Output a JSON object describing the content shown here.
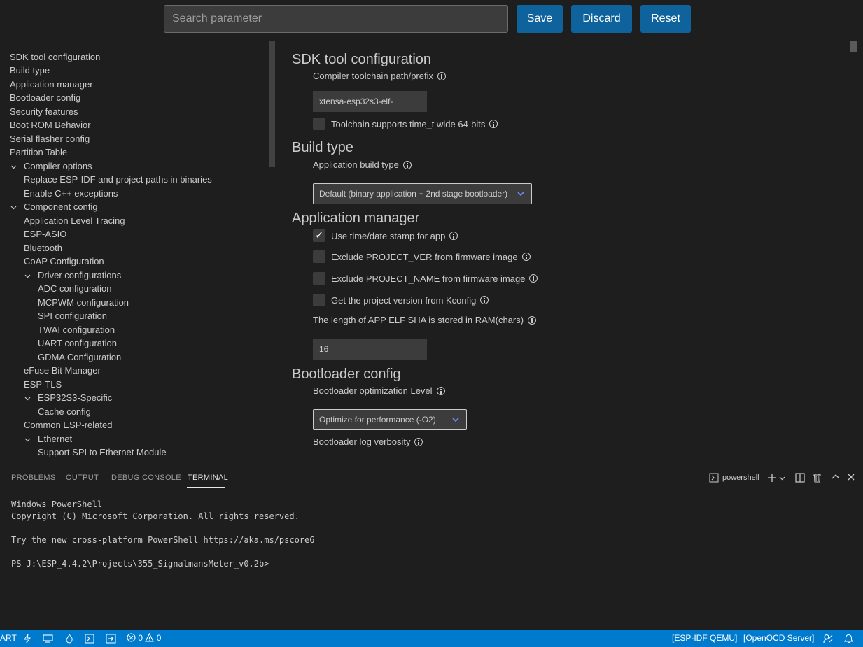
{
  "toolbar": {
    "search_placeholder": "Search parameter",
    "save_label": "Save",
    "discard_label": "Discard",
    "reset_label": "Reset"
  },
  "tree": {
    "items": [
      {
        "label": "SDK tool configuration"
      },
      {
        "label": "Build type"
      },
      {
        "label": "Application manager"
      },
      {
        "label": "Bootloader config"
      },
      {
        "label": "Security features"
      },
      {
        "label": "Boot ROM Behavior"
      },
      {
        "label": "Serial flasher config"
      },
      {
        "label": "Partition Table"
      },
      {
        "label": "Compiler options"
      },
      {
        "label": "Replace ESP-IDF and project paths in binaries"
      },
      {
        "label": "Enable C++ exceptions"
      },
      {
        "label": "Component config"
      },
      {
        "label": "Application Level Tracing"
      },
      {
        "label": "ESP-ASIO"
      },
      {
        "label": "Bluetooth"
      },
      {
        "label": "CoAP Configuration"
      },
      {
        "label": "Driver configurations"
      },
      {
        "label": "ADC configuration"
      },
      {
        "label": "MCPWM configuration"
      },
      {
        "label": "SPI configuration"
      },
      {
        "label": "TWAI configuration"
      },
      {
        "label": "UART configuration"
      },
      {
        "label": "GDMA Configuration"
      },
      {
        "label": "eFuse Bit Manager"
      },
      {
        "label": "ESP-TLS"
      },
      {
        "label": "ESP32S3-Specific"
      },
      {
        "label": "Cache config"
      },
      {
        "label": "Common ESP-related"
      },
      {
        "label": "Ethernet"
      },
      {
        "label": "Support SPI to Ethernet Module"
      }
    ]
  },
  "main": {
    "sdk": {
      "title": "SDK tool configuration",
      "toolchain_label": "Compiler toolchain path/prefix",
      "toolchain_value": "xtensa-esp32s3-elf-",
      "time_t_label": "Toolchain supports time_t wide 64-bits",
      "time_t_checked": false
    },
    "build": {
      "title": "Build type",
      "app_build_label": "Application build type",
      "app_build_value": "Default (binary application + 2nd stage bootloader)"
    },
    "appmgr": {
      "title": "Application manager",
      "timestamp_label": "Use time/date stamp for app",
      "timestamp_checked": true,
      "exclude_ver_label": "Exclude PROJECT_VER from firmware image",
      "exclude_ver_checked": false,
      "exclude_name_label": "Exclude PROJECT_NAME from firmware image",
      "exclude_name_checked": false,
      "kconfig_ver_label": "Get the project version from Kconfig",
      "kconfig_ver_checked": false,
      "sha_len_label": "The length of APP ELF SHA is stored in RAM(chars)",
      "sha_len_value": "16"
    },
    "bootloader": {
      "title": "Bootloader config",
      "opt_label": "Bootloader optimization Level",
      "opt_value": "Optimize for performance (-O2)",
      "log_label": "Bootloader log verbosity"
    }
  },
  "panel": {
    "tabs": [
      "PROBLEMS",
      "OUTPUT",
      "DEBUG CONSOLE",
      "TERMINAL"
    ],
    "active_tab": "TERMINAL",
    "terminal_name": "powershell",
    "terminal_lines": [
      "Windows PowerShell",
      "Copyright (C) Microsoft Corporation. All rights reserved.",
      "",
      "Try the new cross-platform PowerShell https://aka.ms/pscore6",
      "",
      "PS J:\\ESP_4.4.2\\Projects\\355_SignalmansMeter_v0.2b>"
    ]
  },
  "statusbar": {
    "left_text": "ART",
    "errors": "0",
    "warnings": "0",
    "qemu": "[ESP-IDF QEMU]",
    "openocd": "[OpenOCD Server]",
    "color": "#007acc"
  }
}
